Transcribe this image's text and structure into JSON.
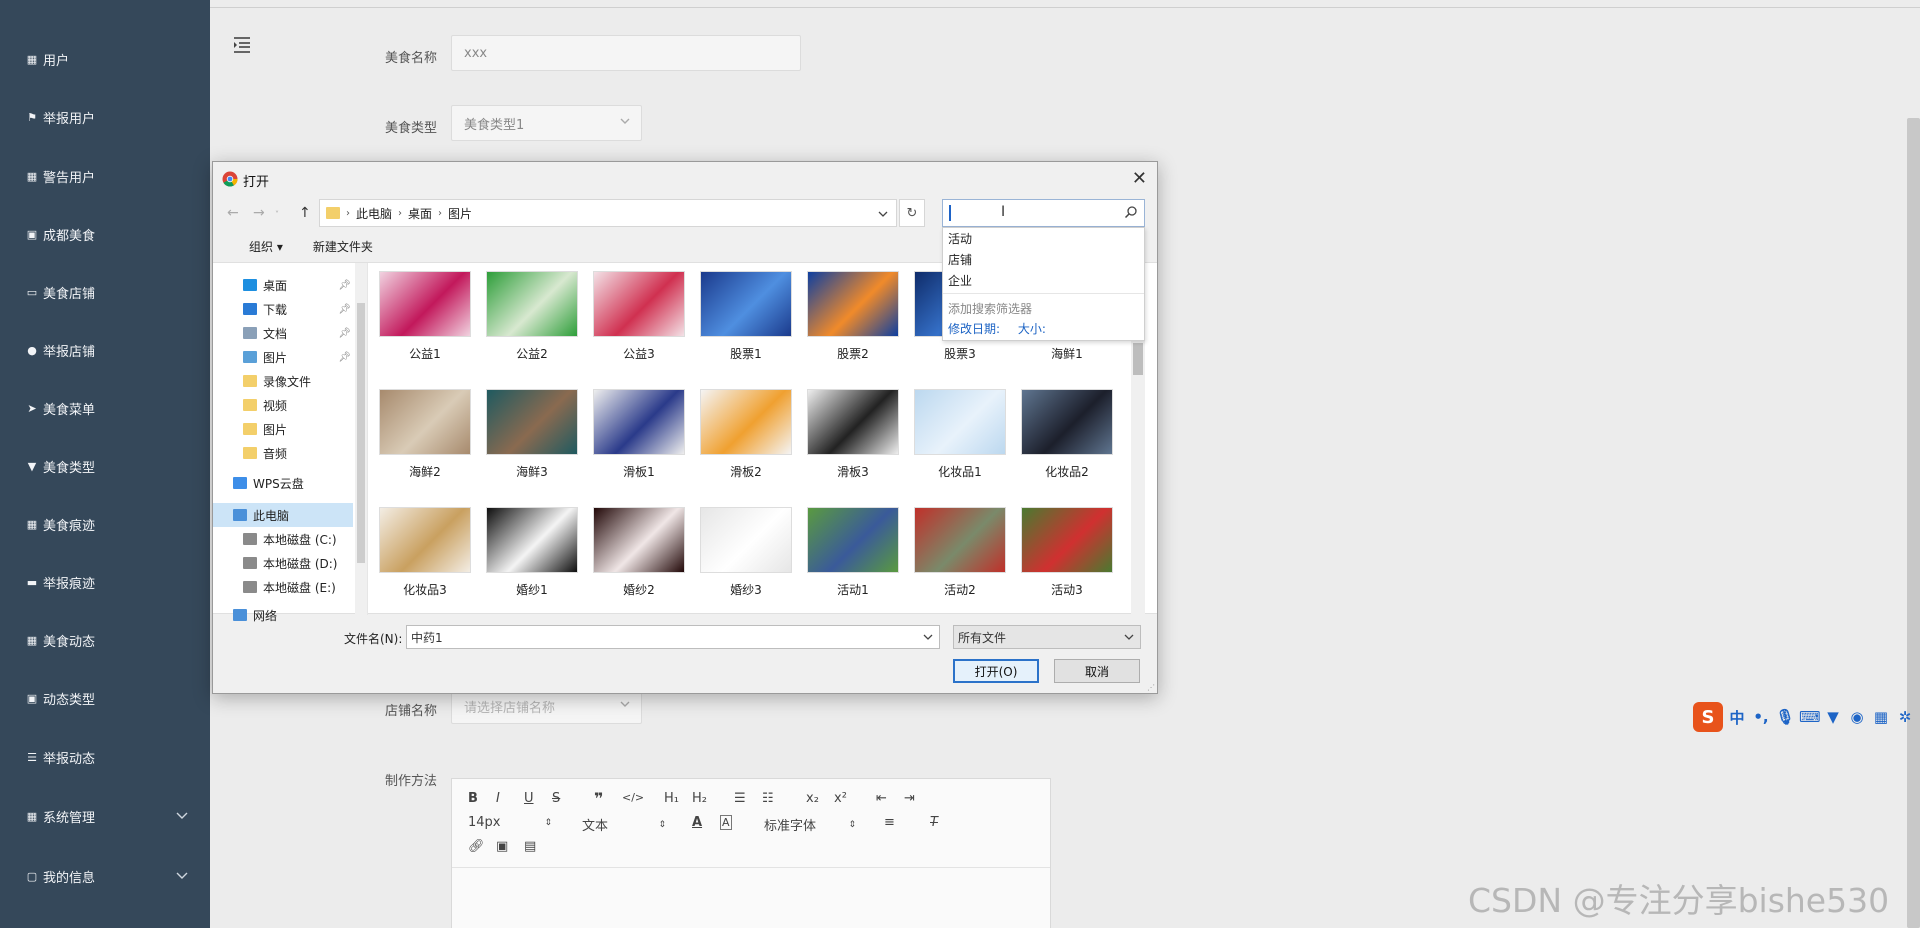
{
  "sidebar": {
    "items": [
      {
        "label": "用户",
        "icon": "grid-icon"
      },
      {
        "label": "举报用户",
        "icon": "flag-icon"
      },
      {
        "label": "警告用户",
        "icon": "grid-icon"
      },
      {
        "label": "成都美食",
        "icon": "clipboard-icon"
      },
      {
        "label": "美食店铺",
        "icon": "monitor-icon"
      },
      {
        "label": "举报店铺",
        "icon": "user-icon"
      },
      {
        "label": "美食菜单",
        "icon": "send-icon"
      },
      {
        "label": "美食类型",
        "icon": "tag-icon"
      },
      {
        "label": "美食痕迹",
        "icon": "grid-icon"
      },
      {
        "label": "举报痕迹",
        "icon": "card-icon"
      },
      {
        "label": "美食动态",
        "icon": "grid-icon"
      },
      {
        "label": "动态类型",
        "icon": "clipboard-icon"
      },
      {
        "label": "举报动态",
        "icon": "sliders-icon"
      },
      {
        "label": "系统管理",
        "icon": "grid-icon"
      },
      {
        "label": "我的信息",
        "icon": "window-icon"
      }
    ],
    "bg": "#35485a"
  },
  "form": {
    "name_label": "美食名称",
    "name_value": "xxx",
    "type_label": "美食类型",
    "type_value": "美食类型1",
    "shop_label": "店铺名称",
    "shop_placeholder": "请选择店铺名称",
    "method_label": "制作方法"
  },
  "editor": {
    "font_size": "14px",
    "block_type": "文本",
    "font_family": "标准字体"
  },
  "dialog": {
    "title": "打开",
    "breadcrumb": [
      "此电脑",
      "桌面",
      "图片"
    ],
    "toolbar": {
      "organize": "组织",
      "new_folder": "新建文件夹"
    },
    "tree": [
      {
        "label": "桌面",
        "pinned": true,
        "color": "#1e8fe0"
      },
      {
        "label": "下载",
        "pinned": true,
        "color": "#2a7bd6"
      },
      {
        "label": "文档",
        "pinned": true,
        "color": "#8aa0b8"
      },
      {
        "label": "图片",
        "pinned": true,
        "color": "#5aa0d8"
      },
      {
        "label": "录像文件",
        "pinned": false,
        "color": "#f3cf6a"
      },
      {
        "label": "视频",
        "pinned": false,
        "color": "#f3cf6a"
      },
      {
        "label": "图片",
        "pinned": false,
        "color": "#f3cf6a"
      },
      {
        "label": "音频",
        "pinned": false,
        "color": "#f3cf6a"
      },
      {
        "label": "WPS云盘",
        "pinned": false,
        "color": "#3d8ee8"
      },
      {
        "label": "此电脑",
        "pinned": false,
        "color": "#4a90d9"
      },
      {
        "label": "本地磁盘 (C:)",
        "pinned": false,
        "color": "#8a8a8a"
      },
      {
        "label": "本地磁盘 (D:)",
        "pinned": false,
        "color": "#8a8a8a"
      },
      {
        "label": "本地磁盘 (E:)",
        "pinned": false,
        "color": "#8a8a8a"
      },
      {
        "label": "网络",
        "pinned": false,
        "color": "#4a90d9"
      }
    ],
    "files": [
      {
        "name": "公益1",
        "c1": "#f1d2e0",
        "c2": "#c2185b"
      },
      {
        "name": "公益2",
        "c1": "#2e9e3a",
        "c2": "#d8e8d0"
      },
      {
        "name": "公益3",
        "c1": "#f3e1e6",
        "c2": "#d03050"
      },
      {
        "name": "股票1",
        "c1": "#1b3a8c",
        "c2": "#4f8fe0"
      },
      {
        "name": "股票2",
        "c1": "#0e3fa0",
        "c2": "#f08a2a"
      },
      {
        "name": "股票3",
        "c1": "#0f2c6a",
        "c2": "#3570c8"
      },
      {
        "name": "海鲜1",
        "c1": "#7b6650",
        "c2": "#cfc2a8"
      },
      {
        "name": "海鲜2",
        "c1": "#a78a6d",
        "c2": "#d9cbb6"
      },
      {
        "name": "海鲜3",
        "c1": "#1f5a60",
        "c2": "#8a6a50"
      },
      {
        "name": "滑板1",
        "c1": "#eeeeee",
        "c2": "#2a3a8a"
      },
      {
        "name": "滑板2",
        "c1": "#f4f4f4",
        "c2": "#f0a030"
      },
      {
        "name": "滑板3",
        "c1": "#eeeeee",
        "c2": "#222222"
      },
      {
        "name": "化妆品1",
        "c1": "#bcd8ef",
        "c2": "#e8f2fb"
      },
      {
        "name": "化妆品2",
        "c1": "#5f7590",
        "c2": "#1c1f2b"
      },
      {
        "name": "化妆品3",
        "c1": "#f3ede4",
        "c2": "#c9a060"
      },
      {
        "name": "婚纱1",
        "c1": "#0e0e0e",
        "c2": "#f4f4f4"
      },
      {
        "name": "婚纱2",
        "c1": "#220808",
        "c2": "#f0e6e6"
      },
      {
        "name": "婚纱3",
        "c1": "#e6e6e6",
        "c2": "#ffffff"
      },
      {
        "name": "活动1",
        "c1": "#5a9a40",
        "c2": "#3a5a9a"
      },
      {
        "name": "活动2",
        "c1": "#c0302a",
        "c2": "#7a8a6a"
      },
      {
        "name": "活动3",
        "c1": "#4a7a30",
        "c2": "#d03030"
      }
    ],
    "search_suggestions": [
      "活动",
      "店铺",
      "企业"
    ],
    "search_hint": "添加搜索筛选器",
    "search_filters": [
      "修改日期:",
      "大小:"
    ],
    "filename_label": "文件名(N):",
    "filename_value": "中药1",
    "filetype_value": "所有文件",
    "open_label": "打开(O)",
    "cancel_label": "取消"
  },
  "ime": {
    "mode": "中"
  },
  "watermark": "CSDN @专注分享bishe530"
}
